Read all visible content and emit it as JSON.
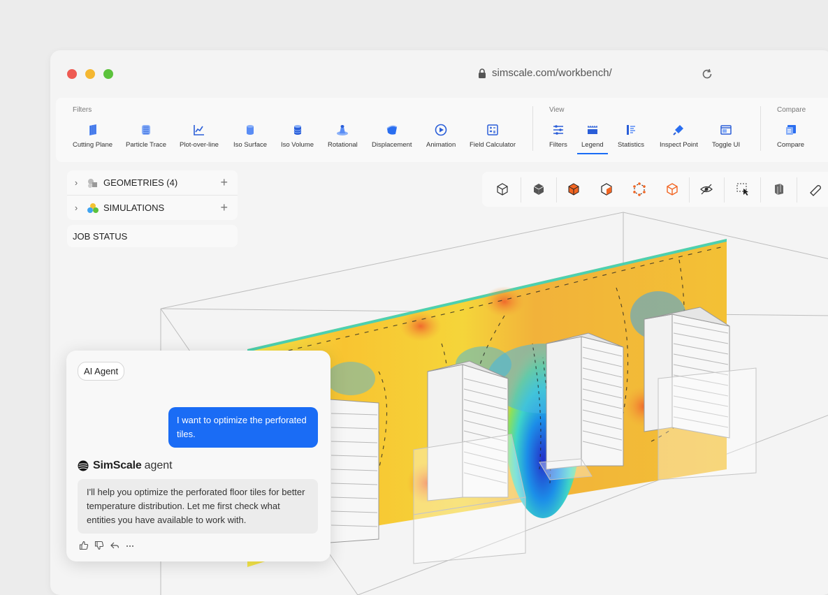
{
  "browser": {
    "url": "simscale.com/workbench/"
  },
  "toolbar": {
    "filters_label": "Filters",
    "view_label": "View",
    "compare_label": "Compare",
    "filters": [
      {
        "label": "Cutting Plane",
        "icon": "cutting-plane-icon"
      },
      {
        "label": "Particle Trace",
        "icon": "particle-trace-icon"
      },
      {
        "label": "Plot-over-line",
        "icon": "plot-over-line-icon"
      },
      {
        "label": "Iso Surface",
        "icon": "iso-surface-icon"
      },
      {
        "label": "Iso Volume",
        "icon": "iso-volume-icon"
      },
      {
        "label": "Rotational",
        "icon": "rotational-icon"
      },
      {
        "label": "Displacement",
        "icon": "displacement-icon"
      },
      {
        "label": "Animation",
        "icon": "animation-icon"
      },
      {
        "label": "Field Calculator",
        "icon": "field-calculator-icon"
      }
    ],
    "view": [
      {
        "label": "Filters",
        "icon": "filters-icon"
      },
      {
        "label": "Legend",
        "icon": "legend-icon",
        "active": true
      },
      {
        "label": "Statistics",
        "icon": "statistics-icon"
      },
      {
        "label": "Inspect Point",
        "icon": "inspect-point-icon"
      },
      {
        "label": "Toggle UI",
        "icon": "toggle-ui-icon"
      }
    ],
    "compare": [
      {
        "label": "Compare",
        "icon": "compare-icon"
      }
    ]
  },
  "tree": {
    "geometries": "GEOMETRIES (4)",
    "simulations": "SIMULATIONS",
    "job_status": "JOB STATUS"
  },
  "colors": {
    "accent": "#1a6cf5"
  },
  "chat": {
    "chip": "AI Agent",
    "user_message": "I want to optimize the perforated tiles.",
    "brand_name": "SimScale",
    "brand_suffix": "agent",
    "agent_message": "I'll help you optimize the perforated floor tiles for better temperature distribution. Let me first check what entities you have available to work with."
  }
}
